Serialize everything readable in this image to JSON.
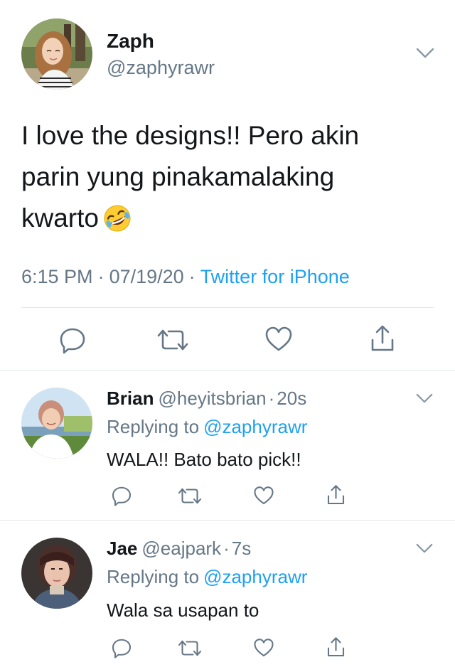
{
  "main_tweet": {
    "author_name": "Zaph",
    "author_handle": "@zaphyrawr",
    "text_line1": "I love the designs!! Pero akin",
    "text_line2": "parin yung pinakamalaking",
    "text_line3": "kwarto",
    "emoji": "rolling-on-floor-laughing-emoji",
    "time": "6:15 PM",
    "date": "07/19/20",
    "separator": "·",
    "source": "Twitter for iPhone",
    "avatar": "avatar-photo",
    "actions": [
      "reply-icon",
      "retweet-icon",
      "like-icon",
      "share-icon"
    ]
  },
  "replies": [
    {
      "author_name": "Brian",
      "author_handle": "@heyitsbrian",
      "dot": "·",
      "time": "20s",
      "replying_label": "Replying to",
      "replying_to": "@zaphyrawr",
      "text": "WALA!! Bato bato pick!!"
    },
    {
      "author_name": "Jae",
      "author_handle": "@eajpark",
      "dot": "·",
      "time": "7s",
      "replying_label": "Replying to",
      "replying_to": "@zaphyrawr",
      "text": "Wala sa usapan to"
    }
  ],
  "colors": {
    "text_primary": "#14171a",
    "text_secondary": "#657786",
    "link": "#1da1f2",
    "divider": "#e1e8ed"
  }
}
